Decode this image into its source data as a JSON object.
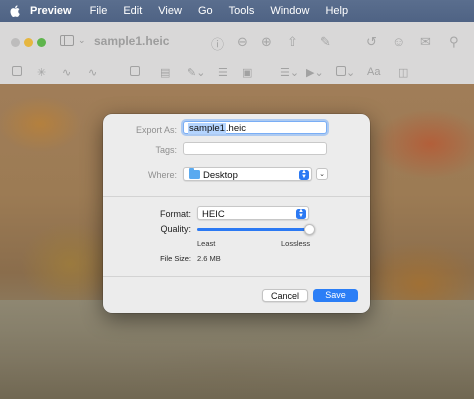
{
  "menubar": {
    "app_name": "Preview",
    "items": [
      "File",
      "Edit",
      "View",
      "Go",
      "Tools",
      "Window",
      "Help"
    ]
  },
  "window": {
    "document_title": "sample1.heic",
    "text_style_label": "Aa"
  },
  "dialog": {
    "export_as_label": "Export As:",
    "filename_selected": "sample1",
    "filename_extension": ".heic",
    "tags_label": "Tags:",
    "where_label": "Where:",
    "where_value": "Desktop",
    "format_label": "Format:",
    "format_value": "HEIC",
    "quality_label": "Quality:",
    "quality_value": 1.0,
    "quality_min_label": "Least",
    "quality_max_label": "Lossless",
    "file_size_label": "File Size:",
    "file_size_value": "2.6 MB",
    "cancel_label": "Cancel",
    "save_label": "Save"
  },
  "colors": {
    "accent": "#2b7ef6",
    "menubar": "#55698a"
  }
}
